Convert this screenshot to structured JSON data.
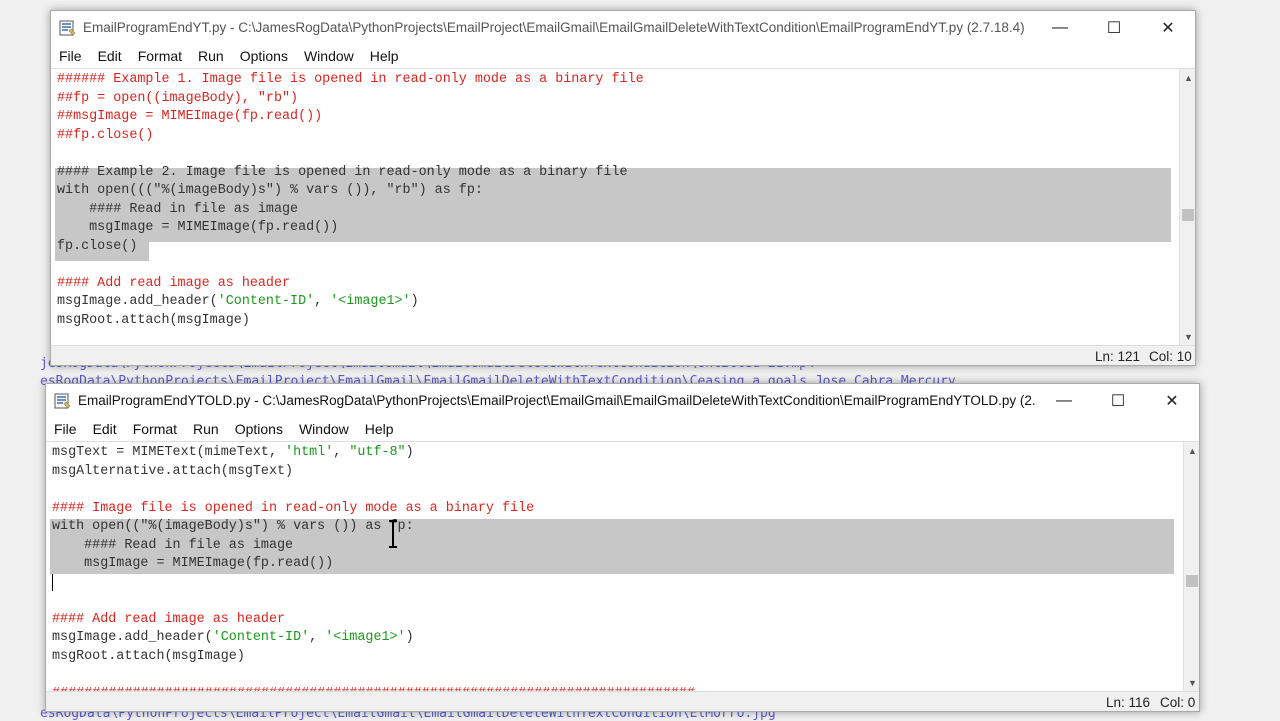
{
  "background_paths": [
    "jesRogData\\PythonProjects\\EmailProject\\EmailGmail\\EmailGmailDeleteWithTextCondition\\Untitled 21.mp4",
    "esRogData\\PythonProjects\\EmailProject\\EmailGmail\\EmailGmailDeleteWithTextCondition\\Ceasing a goals Jose Cabra Mercury",
    "esRogData\\PythonProjects\\EmailProject\\EmailGmail\\EmailGmailDeleteWithTextCondition\\ElMorro.jpg"
  ],
  "window1": {
    "title": "EmailProgramEndYT.py - C:\\JamesRogData\\PythonProjects\\EmailProject\\EmailGmail\\EmailGmailDeleteWithTextCondition\\EmailProgramEndYT.py (2.7.18.4)",
    "menu": [
      "File",
      "Edit",
      "Format",
      "Run",
      "Options",
      "Window",
      "Help"
    ],
    "code": [
      [
        {
          "t": "###### Example 1. Image file is opened in read-only mode as a binary file",
          "c": "c"
        }
      ],
      [
        {
          "t": "##fp = open((imageBody), \"rb\")",
          "c": "c"
        }
      ],
      [
        {
          "t": "##msgImage = MIMEImage(fp.read())",
          "c": "c"
        }
      ],
      [
        {
          "t": "##fp.close()",
          "c": "c"
        }
      ],
      [
        {
          "t": "",
          "c": "k"
        }
      ],
      [
        {
          "t": "#### Example 2. Image file is opened in read-only mode as a binary file",
          "c": "k"
        }
      ],
      [
        {
          "t": "with open(((\"%(imageBody)s\") % vars ()), \"rb\") as fp:",
          "c": "k"
        }
      ],
      [
        {
          "t": "    #### Read in file as image",
          "c": "k"
        }
      ],
      [
        {
          "t": "    msgImage = MIMEImage(fp.read())",
          "c": "k"
        }
      ],
      [
        {
          "t": "fp.close()",
          "c": "k"
        }
      ],
      [
        {
          "t": "",
          "c": "k"
        }
      ],
      [
        {
          "t": "#### Add read image as header",
          "c": "c"
        }
      ],
      [
        {
          "t": "msgImage.add_header(",
          "c": "k"
        },
        {
          "t": "'Content-ID'",
          "c": "s"
        },
        {
          "t": ", ",
          "c": "k"
        },
        {
          "t": "'<image1>'",
          "c": "s"
        },
        {
          "t": ")",
          "c": "k"
        }
      ],
      [
        {
          "t": "msgRoot.attach(msgImage)",
          "c": "k"
        }
      ]
    ],
    "status": {
      "ln": "Ln: 121",
      "col": "Col: 10"
    }
  },
  "window2": {
    "title": "EmailProgramEndYTOLD.py - C:\\JamesRogData\\PythonProjects\\EmailProject\\EmailGmail\\EmailGmailDeleteWithTextCondition\\EmailProgramEndYTOLD.py (2....",
    "menu": [
      "File",
      "Edit",
      "Format",
      "Run",
      "Options",
      "Window",
      "Help"
    ],
    "code": [
      [
        {
          "t": "msgText = MIMEText(mimeText, ",
          "c": "k"
        },
        {
          "t": "'html'",
          "c": "s"
        },
        {
          "t": ", ",
          "c": "k"
        },
        {
          "t": "\"utf-8\"",
          "c": "s"
        },
        {
          "t": ")",
          "c": "k"
        }
      ],
      [
        {
          "t": "msgAlternative.attach(msgText)",
          "c": "k"
        }
      ],
      [
        {
          "t": "",
          "c": "k"
        }
      ],
      [
        {
          "t": "#### Image file is opened in read-only mode as a binary file",
          "c": "c"
        }
      ],
      [
        {
          "t": "with open((\"%(imageBody)s\") % vars ()) as fp:",
          "c": "k"
        }
      ],
      [
        {
          "t": "    #### Read in file as image",
          "c": "k"
        }
      ],
      [
        {
          "t": "    msgImage = MIMEImage(fp.read())",
          "c": "k"
        }
      ],
      [
        {
          "t": "",
          "c": "k"
        }
      ],
      [
        {
          "t": "",
          "c": "k"
        }
      ],
      [
        {
          "t": "#### Add read image as header",
          "c": "c"
        }
      ],
      [
        {
          "t": "msgImage.add_header(",
          "c": "k"
        },
        {
          "t": "'Content-ID'",
          "c": "s"
        },
        {
          "t": ", ",
          "c": "k"
        },
        {
          "t": "'<image1>'",
          "c": "s"
        },
        {
          "t": ")",
          "c": "k"
        }
      ],
      [
        {
          "t": "msgRoot.attach(msgImage)",
          "c": "k"
        }
      ],
      [
        {
          "t": "",
          "c": "k"
        }
      ],
      [
        {
          "t": "################################################################################",
          "c": "c"
        }
      ]
    ],
    "status": {
      "ln": "Ln: 116",
      "col": "Col: 0"
    }
  },
  "colors": {
    "comment": "#d8261f",
    "string": "#1a9a1a",
    "selection": "#c7c7c7"
  }
}
